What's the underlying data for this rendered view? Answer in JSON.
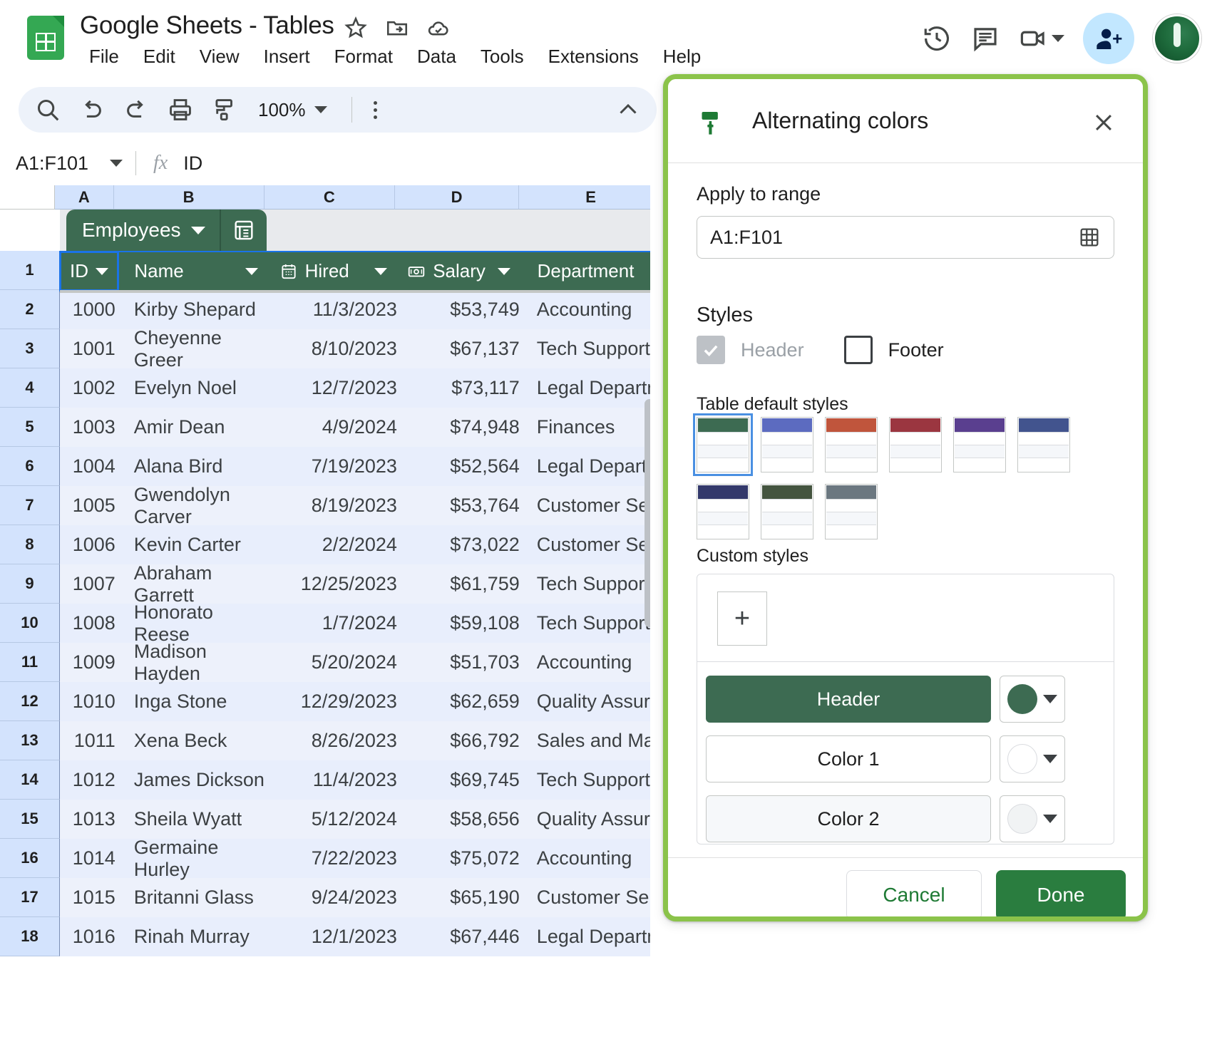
{
  "app": {
    "doc_title": "Google Sheets - Tables",
    "title_icons": [
      "star-icon",
      "move-to-folder-icon",
      "cloud-saved-icon"
    ],
    "menus": [
      "File",
      "Edit",
      "View",
      "Insert",
      "Format",
      "Data",
      "Tools",
      "Extensions",
      "Help"
    ],
    "right_icons": [
      "version-history-icon",
      "comment-icon",
      "video-call-icon"
    ],
    "accent_green": "#2a7d3f",
    "table_green": "#3d6b52",
    "selection_blue": "#1a73e8",
    "glow_green": "#8bc34a"
  },
  "toolbar": {
    "icons": [
      "search-icon",
      "undo-icon",
      "redo-icon",
      "print-icon",
      "paint-format-icon"
    ],
    "zoom": "100%",
    "more_label": "More",
    "collapse_label": "Hide the menus"
  },
  "formula_bar": {
    "name_box": "A1:F101",
    "fx_label": "fx",
    "value": "ID"
  },
  "grid": {
    "column_headers": [
      "A",
      "B",
      "C",
      "D",
      "E"
    ],
    "table_tab": {
      "name": "Employees",
      "icon": "table-icon"
    },
    "row_numbers": [
      "1",
      "2",
      "3",
      "4",
      "5",
      "6",
      "7",
      "8",
      "9",
      "10",
      "11",
      "12",
      "13",
      "14",
      "15",
      "16",
      "17",
      "18"
    ],
    "headers": [
      {
        "label": "ID",
        "icon": null,
        "selected": true
      },
      {
        "label": "Name",
        "icon": null,
        "selected": false
      },
      {
        "label": "Hired",
        "icon": "calendar-icon",
        "selected": false
      },
      {
        "label": "Salary",
        "icon": "money-icon",
        "selected": false
      },
      {
        "label": "Department",
        "icon": null,
        "selected": false
      }
    ],
    "rows": [
      {
        "row": "2",
        "id": "1000",
        "name": "Kirby Shepard",
        "hired": "11/3/2023",
        "salary": "$53,749",
        "department": "Accounting"
      },
      {
        "row": "3",
        "id": "1001",
        "name": "Cheyenne Greer",
        "hired": "8/10/2023",
        "salary": "$67,137",
        "department": "Tech Support"
      },
      {
        "row": "4",
        "id": "1002",
        "name": "Evelyn Noel",
        "hired": "12/7/2023",
        "salary": "$73,117",
        "department": "Legal Department"
      },
      {
        "row": "5",
        "id": "1003",
        "name": "Amir Dean",
        "hired": "4/9/2024",
        "salary": "$74,948",
        "department": "Finances"
      },
      {
        "row": "6",
        "id": "1004",
        "name": "Alana Bird",
        "hired": "7/19/2023",
        "salary": "$52,564",
        "department": "Legal Department"
      },
      {
        "row": "7",
        "id": "1005",
        "name": "Gwendolyn Carver",
        "hired": "8/19/2023",
        "salary": "$53,764",
        "department": "Customer Service"
      },
      {
        "row": "8",
        "id": "1006",
        "name": "Kevin Carter",
        "hired": "2/2/2024",
        "salary": "$73,022",
        "department": "Customer Service"
      },
      {
        "row": "9",
        "id": "1007",
        "name": "Abraham Garrett",
        "hired": "12/25/2023",
        "salary": "$61,759",
        "department": "Tech Support"
      },
      {
        "row": "10",
        "id": "1008",
        "name": "Honorato Reese",
        "hired": "1/7/2024",
        "salary": "$59,108",
        "department": "Tech Support"
      },
      {
        "row": "11",
        "id": "1009",
        "name": "Madison Hayden",
        "hired": "5/20/2024",
        "salary": "$51,703",
        "department": "Accounting"
      },
      {
        "row": "12",
        "id": "1010",
        "name": "Inga Stone",
        "hired": "12/29/2023",
        "salary": "$62,659",
        "department": "Quality Assurance"
      },
      {
        "row": "13",
        "id": "1011",
        "name": "Xena Beck",
        "hired": "8/26/2023",
        "salary": "$66,792",
        "department": "Sales and Marketing"
      },
      {
        "row": "14",
        "id": "1012",
        "name": "James Dickson",
        "hired": "11/4/2023",
        "salary": "$69,745",
        "department": "Tech Support"
      },
      {
        "row": "15",
        "id": "1013",
        "name": "Sheila Wyatt",
        "hired": "5/12/2024",
        "salary": "$58,656",
        "department": "Quality Assurance"
      },
      {
        "row": "16",
        "id": "1014",
        "name": "Germaine Hurley",
        "hired": "7/22/2023",
        "salary": "$75,072",
        "department": "Accounting"
      },
      {
        "row": "17",
        "id": "1015",
        "name": "Britanni Glass",
        "hired": "9/24/2023",
        "salary": "$65,190",
        "department": "Customer Service"
      },
      {
        "row": "18",
        "id": "1016",
        "name": "Rinah Murray",
        "hired": "12/1/2023",
        "salary": "$67,446",
        "department": "Legal Department"
      }
    ]
  },
  "dialog": {
    "icon": "paint-roller-icon",
    "title": "Alternating colors",
    "close_label": "Close",
    "apply_to_range_label": "Apply to range",
    "range_value": "A1:F101",
    "range_picker_icon": "select-range-icon",
    "styles_label": "Styles",
    "header_checkbox": {
      "label": "Header",
      "checked": true,
      "disabled": true
    },
    "footer_checkbox": {
      "label": "Footer",
      "checked": false,
      "disabled": false
    },
    "table_default_styles_label": "Table default styles",
    "default_styles": [
      {
        "color": "#3d6b52",
        "selected": true
      },
      {
        "color": "#5c6bc0",
        "selected": false
      },
      {
        "color": "#c0553c",
        "selected": false
      },
      {
        "color": "#9b3640",
        "selected": false
      },
      {
        "color": "#5a3f8f",
        "selected": false
      },
      {
        "color": "#42548e",
        "selected": false
      },
      {
        "color": "#33396b",
        "selected": false
      },
      {
        "color": "#44543f",
        "selected": false
      },
      {
        "color": "#6b7780",
        "selected": false
      }
    ],
    "custom_styles_label": "Custom styles",
    "add_custom_label": "+",
    "custom_rows": [
      {
        "label": "Header",
        "swatch": "#3d6b52",
        "kind": "header"
      },
      {
        "label": "Color 1",
        "swatch": "#ffffff",
        "kind": "color1"
      },
      {
        "label": "Color 2",
        "swatch": "#f1f3f4",
        "kind": "color2"
      }
    ],
    "cancel_label": "Cancel",
    "done_label": "Done"
  }
}
